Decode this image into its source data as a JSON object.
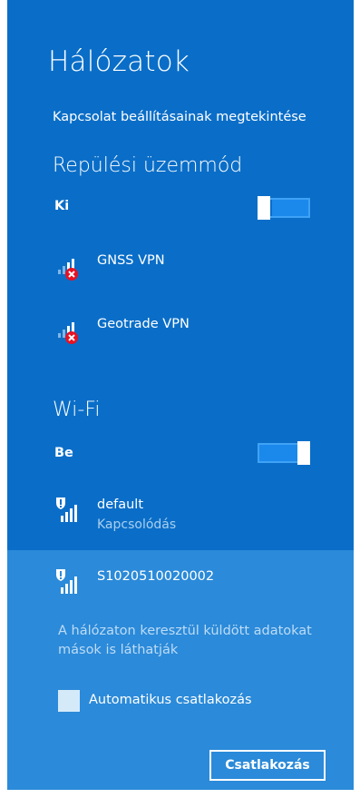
{
  "panel": {
    "title": "Hálózatok",
    "view_settings_link": "Kapcsolat beállításainak megtekintése"
  },
  "airplane_mode": {
    "header": "Repülési üzemmód",
    "state_label": "Ki",
    "on": false
  },
  "vpn_networks": [
    {
      "name": "GNSS VPN",
      "icon": "vpn-signal-disconnected-icon"
    },
    {
      "name": "Geotrade VPN",
      "icon": "vpn-signal-disconnected-icon"
    }
  ],
  "wifi": {
    "header": "Wi-Fi",
    "state_label": "Be",
    "on": true,
    "networks": [
      {
        "name": "default",
        "status": "Kapcsolódás",
        "icon": "wifi-unsecured-icon"
      },
      {
        "name": "S1020510020002",
        "icon": "wifi-unsecured-icon",
        "selected": true
      }
    ],
    "warning": "A hálózaton keresztül küldött adatokat mások is láthatják",
    "auto_connect_label": "Automatikus csatlakozás",
    "auto_connect_checked": false,
    "connect_button": "Csatlakozás"
  },
  "colors": {
    "panel_bg": "#0a6ec8",
    "selected_bg": "#2b8ad9",
    "toggle_fill": "#1b89ec",
    "error_red": "#e81123"
  }
}
